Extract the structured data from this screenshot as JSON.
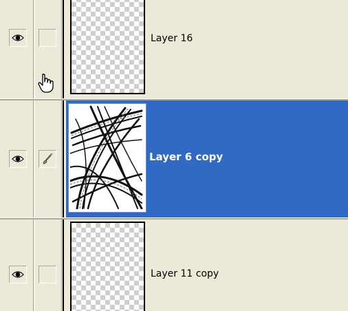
{
  "layers": [
    {
      "name": "Layer 16",
      "visible": true,
      "linked": false,
      "selected": false,
      "thumbnail": "transparent"
    },
    {
      "name": "Layer 6 copy",
      "visible": true,
      "linked": true,
      "selected": true,
      "thumbnail": "brush-strokes"
    },
    {
      "name": "Layer 11 copy",
      "visible": true,
      "linked": false,
      "selected": false,
      "thumbnail": "transparent"
    }
  ],
  "icons": {
    "visibility": "eye-icon",
    "link": "brush-icon",
    "cursor": "hand-cursor-icon"
  },
  "colors": {
    "panel_bg": "#ece9d8",
    "selection": "#316ac5",
    "selected_text": "#ffffff",
    "text": "#000000"
  }
}
